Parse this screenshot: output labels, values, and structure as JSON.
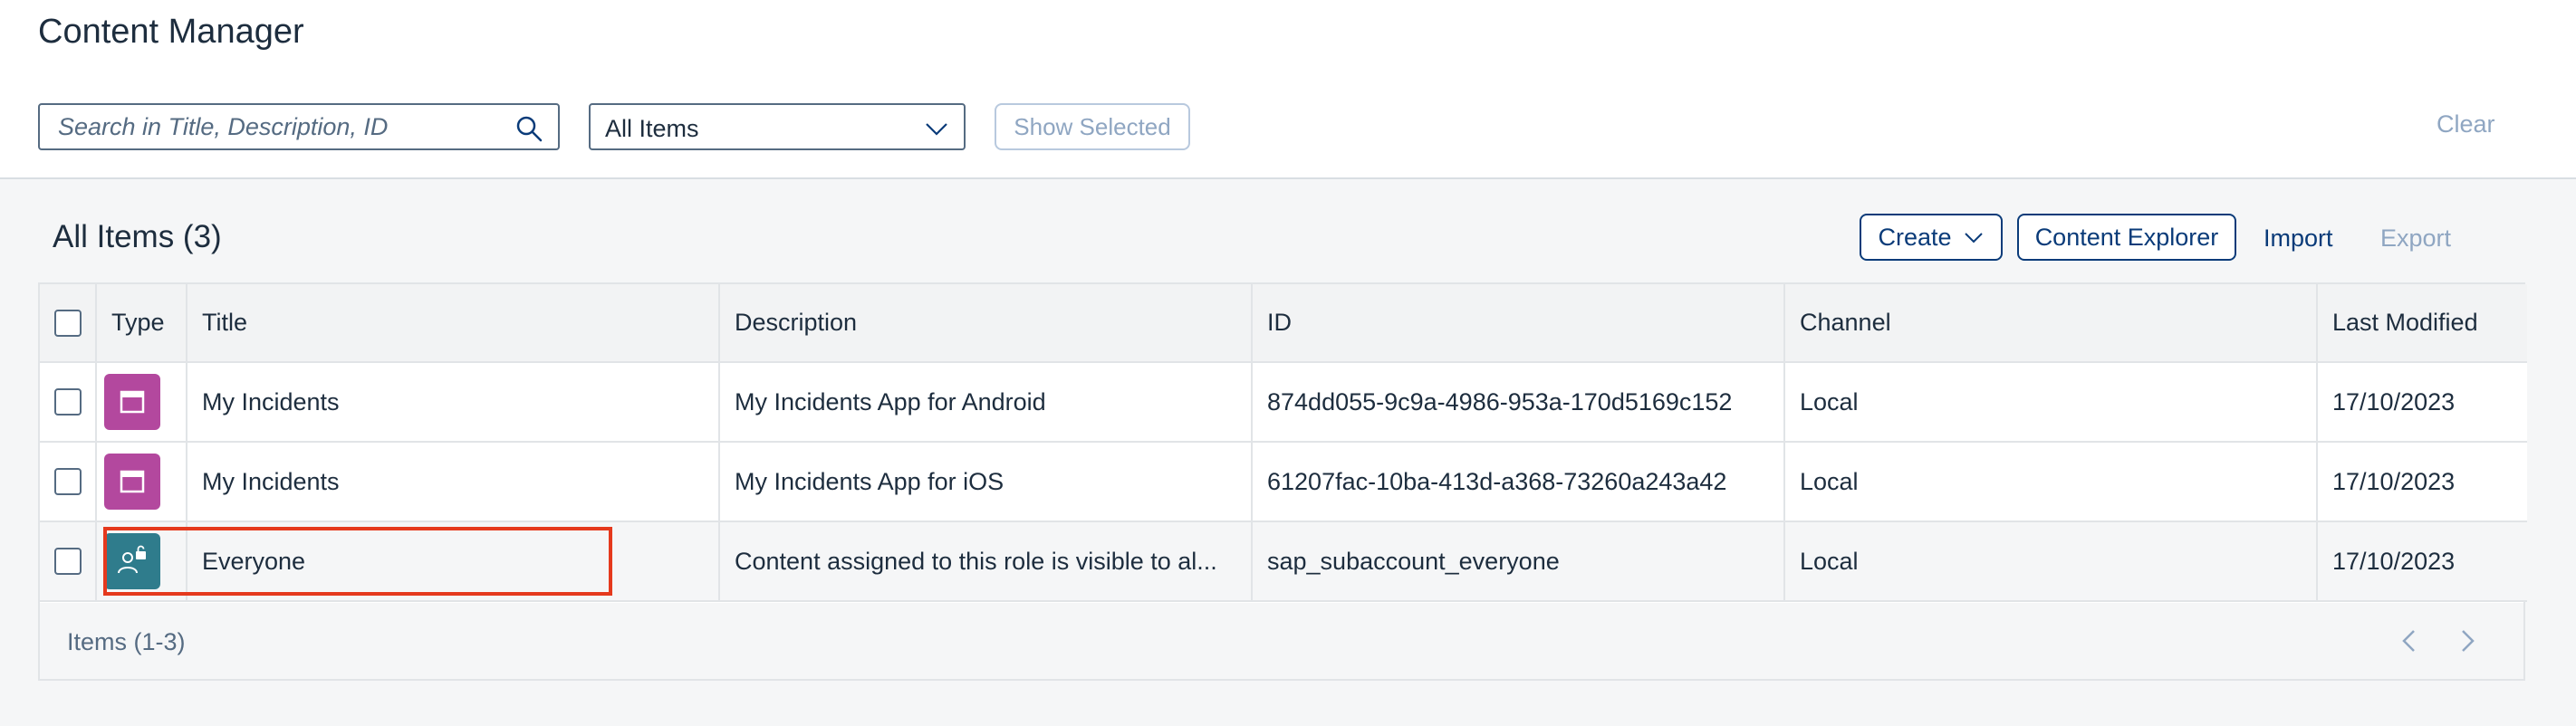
{
  "page": {
    "title": "Content Manager"
  },
  "filters": {
    "search_placeholder": "Search in Title, Description, ID",
    "search_value": "",
    "type_filter_value": "All Items",
    "show_selected_label": "Show Selected",
    "clear_label": "Clear"
  },
  "toolbar": {
    "list_title": "All Items (3)",
    "create_label": "Create",
    "content_explorer_label": "Content Explorer",
    "import_label": "Import",
    "export_label": "Export"
  },
  "table": {
    "columns": [
      "Type",
      "Title",
      "Description",
      "ID",
      "Channel",
      "Last Modified"
    ],
    "rows": [
      {
        "type_icon": "app-window-icon",
        "title": "My Incidents",
        "description": "My Incidents App for Android",
        "id": "874dd055-9c9a-4986-953a-170d5169c152",
        "channel": "Local",
        "last_modified": "17/10/2023"
      },
      {
        "type_icon": "app-window-icon",
        "title": "My Incidents",
        "description": "My Incidents App for iOS",
        "id": "61207fac-10ba-413d-a368-73260a243a42",
        "channel": "Local",
        "last_modified": "17/10/2023"
      },
      {
        "type_icon": "role-icon",
        "title": "Everyone",
        "description": "Content assigned to this role is visible to al...",
        "id": "sap_subaccount_everyone",
        "channel": "Local",
        "last_modified": "17/10/2023"
      }
    ],
    "footer_count": "Items (1-3)"
  },
  "colors": {
    "accent": "#0a3b79",
    "app_icon_bg": "#b3489e",
    "role_icon_bg": "#2f7c8c",
    "highlight": "#e5391d"
  }
}
